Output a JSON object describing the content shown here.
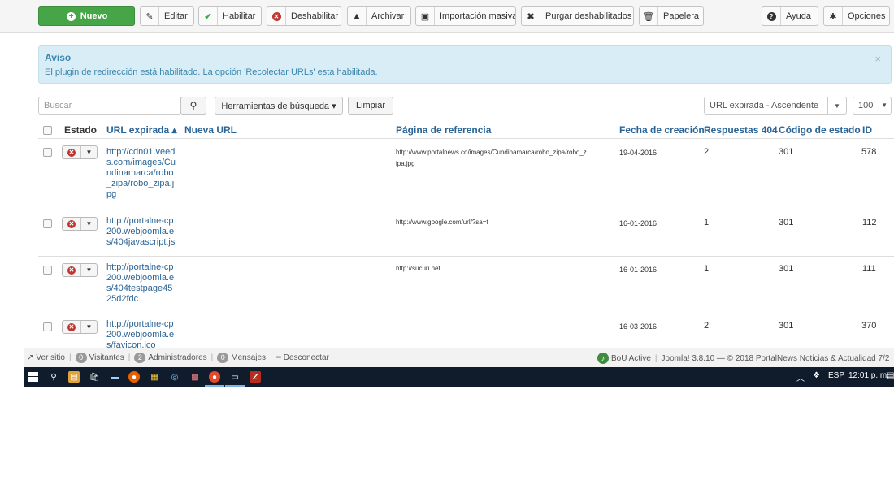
{
  "toolbar": {
    "buttons": [
      {
        "label": "Nuevo",
        "icon": "plus-circle-icon"
      },
      {
        "label": "Editar",
        "icon": "edit-icon"
      },
      {
        "label": "Habilitar",
        "icon": "check-icon"
      },
      {
        "label": "Deshabilitar",
        "icon": "disable-circle-icon"
      },
      {
        "label": "Archivar",
        "icon": "archive-icon"
      },
      {
        "label": "Importación masiva",
        "icon": "import-icon"
      },
      {
        "label": "Purgar deshabilitados",
        "icon": "x-icon"
      },
      {
        "label": "Papelera",
        "icon": "trash-icon"
      },
      {
        "label": "Ayuda",
        "icon": "help-icon"
      },
      {
        "label": "Opciones",
        "icon": "gear-icon"
      }
    ]
  },
  "notice": {
    "title": "Aviso",
    "message": "El plugin de redirección está habilitado. La opción 'Recolectar URLs' esta habilitada.",
    "close": "×"
  },
  "filters": {
    "search_placeholder": "Buscar",
    "search_tools_label": "Herramientas de búsqueda ▾",
    "clear_label": "Limpiar",
    "sort_value": "URL expirada - Ascendente",
    "limit_value": "100"
  },
  "table": {
    "headers": {
      "status": "Estado",
      "old_url": "URL expirada ▴",
      "new_url": "Nueva URL",
      "referer": "Página de referencia",
      "created": "Fecha de creación",
      "hits": "Respuestas 404",
      "code": "Código de estado",
      "id": "ID"
    },
    "rows": [
      {
        "old_url": "http://cdn01.veed\ns.com/images/Cu\nndinamarca/robo\n_zipa/robo_zipa.j\npg",
        "new_url": "",
        "referer": "http://www.portalnews.co/images/Cundinamarca/robo_zipa/robo_z\nipa.jpg",
        "created": "19-04-2016",
        "hits": "2",
        "code": "301",
        "id": "578"
      },
      {
        "old_url": "http://portalne-cp\n200.webjoomla.e\ns/404javascript.js",
        "new_url": "",
        "referer": "http://www.google.com/url/?sa=t",
        "created": "16-01-2016",
        "hits": "1",
        "code": "301",
        "id": "112"
      },
      {
        "old_url": "http://portalne-cp\n200.webjoomla.e\ns/404testpage45\n25d2fdc",
        "new_url": "",
        "referer": "http://sucuri.net",
        "created": "16-01-2016",
        "hits": "1",
        "code": "301",
        "id": "111"
      },
      {
        "old_url": "http://portalne-cp\n200.webjoomla.e\ns/favicon.ico",
        "new_url": "",
        "referer": "",
        "created": "16-03-2016",
        "hits": "2",
        "code": "301",
        "id": "370"
      }
    ]
  },
  "statusbar": {
    "view_site": "Ver sitio",
    "visitors_count": "0",
    "visitors_label": "Visitantes",
    "admins_count": "2",
    "admins_label": "Administradores",
    "messages_count": "0",
    "messages_label": "Mensajes",
    "logout": "Desconectar",
    "bou": "BoU Active",
    "footer": "Joomla! 3.8.10 — © 2018 PortalNews Noticias & Actualidad 7/2"
  },
  "taskbar": {
    "lang": "ESP",
    "time": "12:01 p. m."
  }
}
